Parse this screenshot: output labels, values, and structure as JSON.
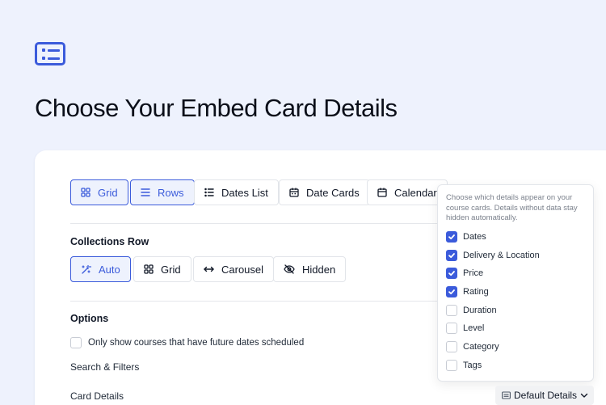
{
  "page": {
    "title": "Choose Your Embed Card Details",
    "icon": "list-card-icon"
  },
  "layout_buttons": [
    {
      "label": "Grid",
      "icon": "grid-icon",
      "active": true
    },
    {
      "label": "Rows",
      "icon": "rows-icon",
      "active": true
    },
    {
      "label": "Dates List",
      "icon": "list-icon",
      "active": false
    },
    {
      "label": "Date Cards",
      "icon": "calendar-grid-icon",
      "active": false
    },
    {
      "label": "Calendar",
      "icon": "calendar-icon",
      "active": false
    }
  ],
  "collections": {
    "label": "Collections Row",
    "buttons": [
      {
        "label": "Auto",
        "icon": "magic-wand-icon",
        "active": true
      },
      {
        "label": "Grid",
        "icon": "grid-icon",
        "active": false
      },
      {
        "label": "Carousel",
        "icon": "arrows-horizontal-icon",
        "active": false
      },
      {
        "label": "Hidden",
        "icon": "eye-off-icon",
        "active": false
      }
    ]
  },
  "options": {
    "label": "Options",
    "future_dates": {
      "label": "Only show courses that have future dates scheduled",
      "checked": false
    },
    "search_filters_label": "Search & Filters",
    "card_details_label": "Card Details"
  },
  "card_details_popup": {
    "help": "Choose which details appear on your course cards. Details without data stay hidden automatically.",
    "items": [
      {
        "label": "Dates",
        "checked": true
      },
      {
        "label": "Delivery & Location",
        "checked": true
      },
      {
        "label": "Price",
        "checked": true
      },
      {
        "label": "Rating",
        "checked": true
      },
      {
        "label": "Duration",
        "checked": false
      },
      {
        "label": "Level",
        "checked": false
      },
      {
        "label": "Category",
        "checked": false
      },
      {
        "label": "Tags",
        "checked": false
      }
    ]
  },
  "card_details_dropdown": {
    "label": "Default Details",
    "icon": "card-icon",
    "chevron": "chevron-down-icon"
  },
  "colors": {
    "accent": "#3b5bdb",
    "background": "#eef2fd",
    "panel": "#ffffff"
  }
}
